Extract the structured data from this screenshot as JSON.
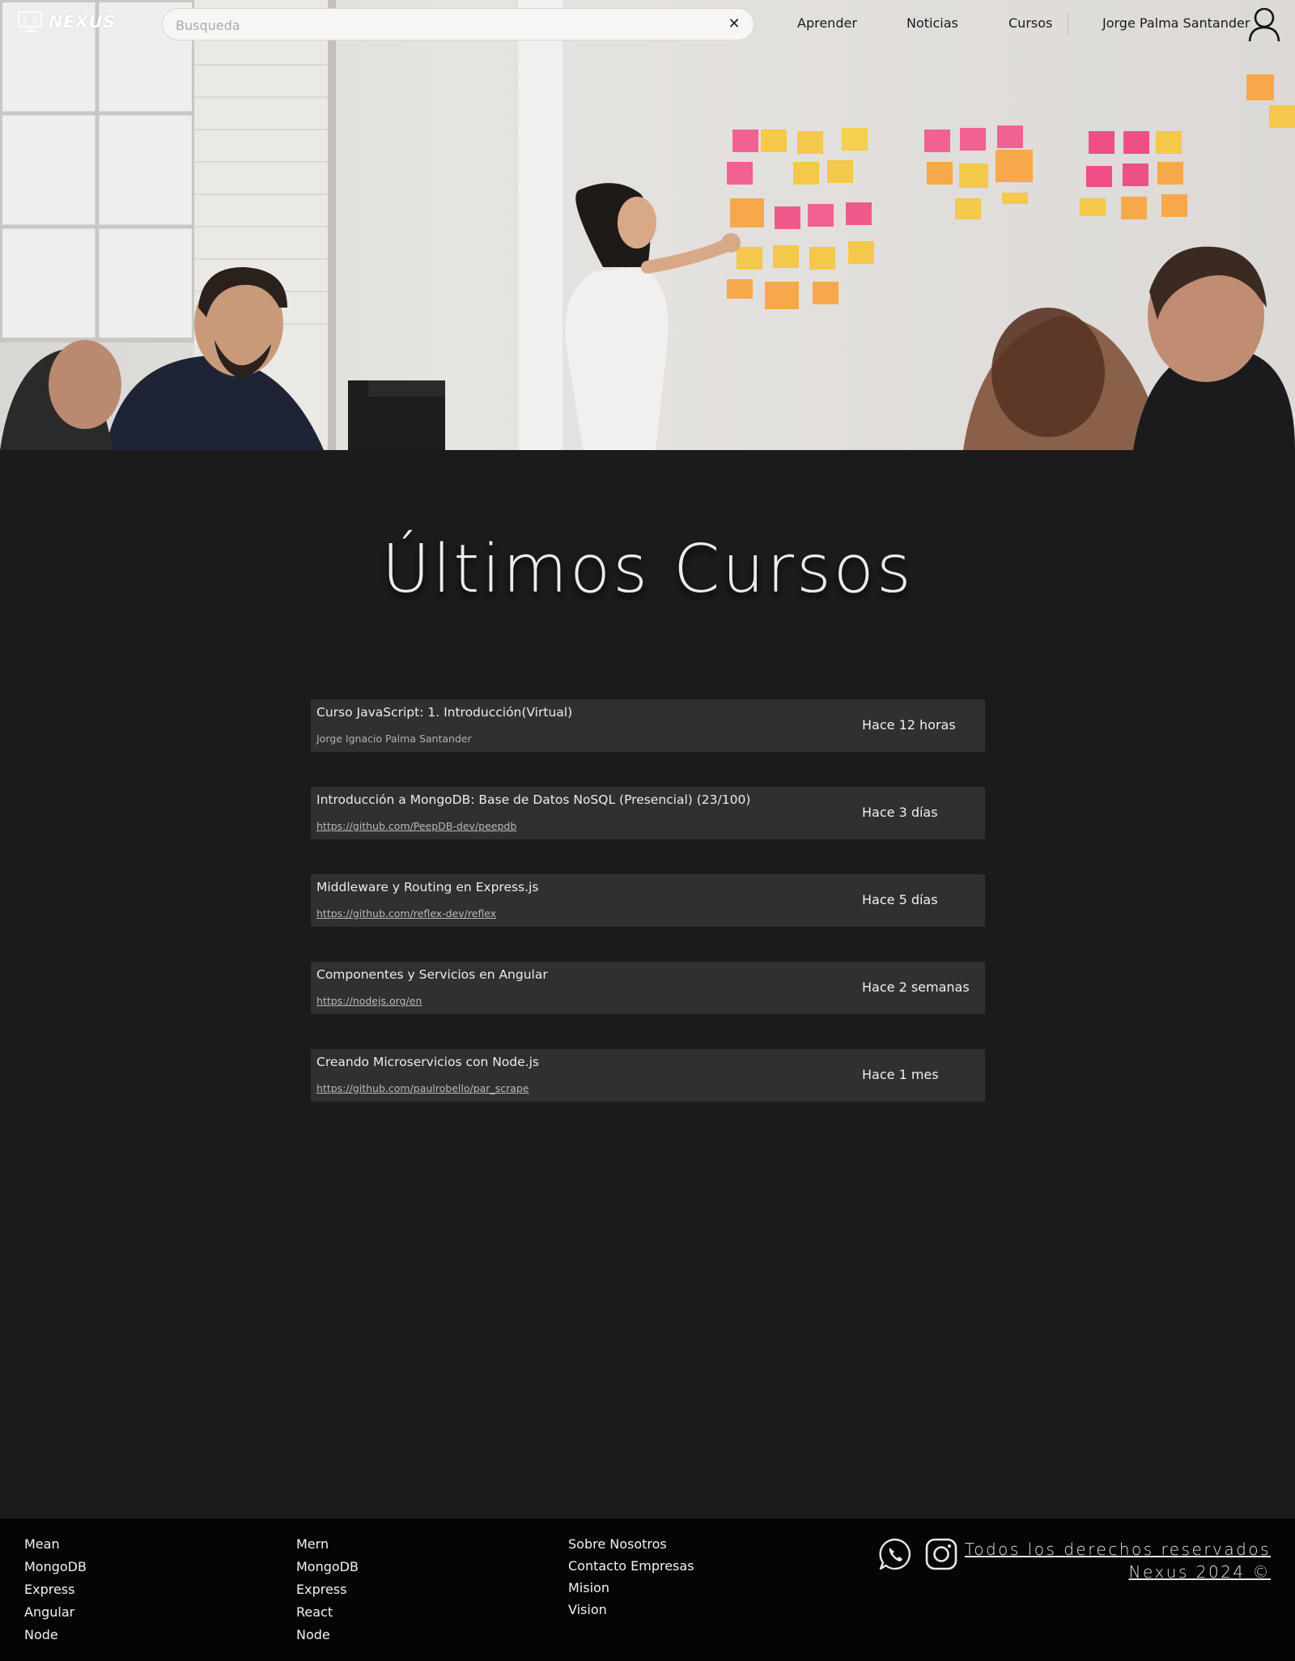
{
  "brand": {
    "name": "NEXUS"
  },
  "search": {
    "placeholder": "Busqueda",
    "value": "",
    "clear_label": "✕"
  },
  "nav": {
    "items": [
      {
        "label": "Aprender"
      },
      {
        "label": "Noticias"
      },
      {
        "label": "Cursos"
      }
    ]
  },
  "user": {
    "name": "Jorge Palma Santander"
  },
  "main": {
    "title": "Últimos Cursos",
    "courses": [
      {
        "title": "Curso JavaScript: 1. Introducción(Virtual)",
        "subtitle": "Jorge Ignacio Palma Santander",
        "is_link": false,
        "time": "Hace 12 horas"
      },
      {
        "title": "Introducción a MongoDB: Base de Datos NoSQL (Presencial) (23/100)",
        "subtitle": "https://github.com/PeepDB-dev/peepdb",
        "is_link": true,
        "time": "Hace 3 días"
      },
      {
        "title": "Middleware y Routing en Express.js",
        "subtitle": "https://github.com/reflex-dev/reflex",
        "is_link": true,
        "time": "Hace 5 días"
      },
      {
        "title": "Componentes y Servicios en Angular",
        "subtitle": "https://nodejs.org/en",
        "is_link": true,
        "time": "Hace 2 semanas"
      },
      {
        "title": "Creando Microservicios con Node.js",
        "subtitle": "https://github.com/paulrobello/par_scrape",
        "is_link": true,
        "time": "Hace 1 mes"
      }
    ]
  },
  "footer": {
    "mean": [
      "Mean",
      "MongoDB",
      "Express",
      "Angular",
      "Node"
    ],
    "mern": [
      "Mern",
      "MongoDB",
      "Express",
      "React",
      "Node"
    ],
    "about": [
      "Sobre Nosotros",
      "Contacto Empresas",
      "Mision",
      "Vision"
    ],
    "rights_line1": "Todos los derechos reservados",
    "rights_line2": "Nexus 2024 ©"
  },
  "icons": {
    "logo": "monitor-icon",
    "clear": "close-icon",
    "avatar": "user-icon",
    "social": [
      "whatsapp-icon",
      "instagram-icon"
    ]
  },
  "colors": {
    "page_bg": "#1b1b1b",
    "card_bg": "#303030",
    "footer_bg": "#050505",
    "text": "#ececec"
  }
}
